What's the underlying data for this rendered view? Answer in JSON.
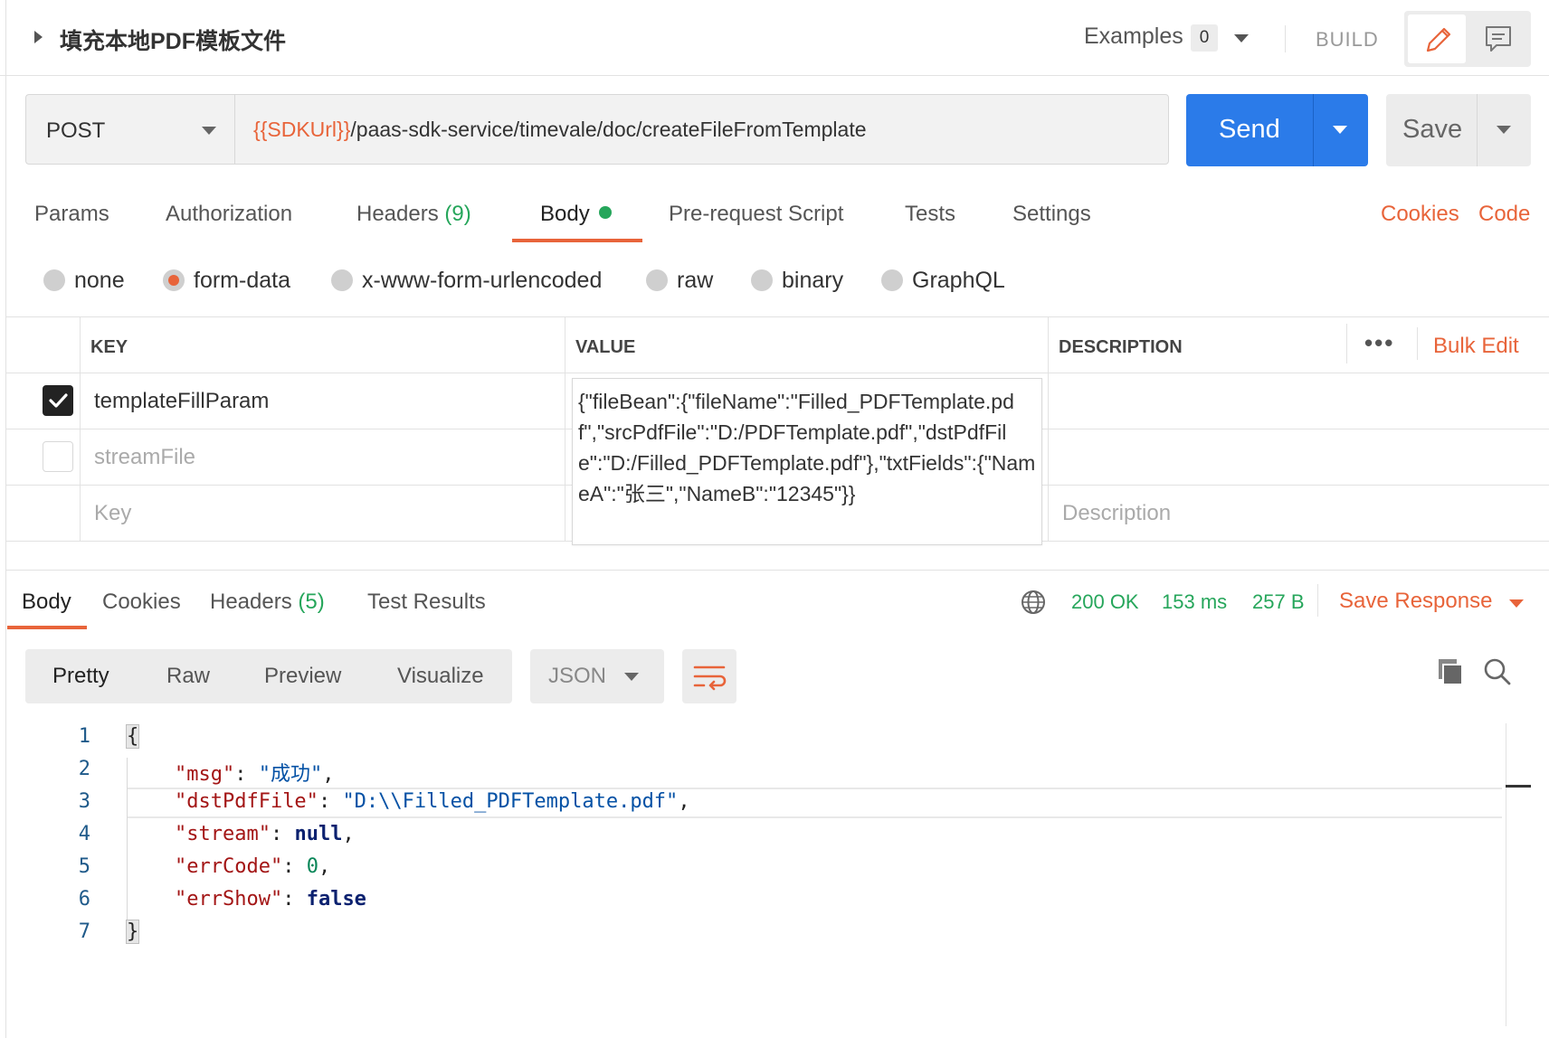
{
  "request": {
    "title": "填充本地PDF模板文件",
    "examples_label": "Examples",
    "examples_count": "0",
    "build_label": "BUILD",
    "method": "POST",
    "url_variable": "{{SDKUrl}}",
    "url_path": "/paas-sdk-service/timevale/doc/createFileFromTemplate",
    "send_label": "Send",
    "save_label": "Save"
  },
  "request_tabs": {
    "params": "Params",
    "authorization": "Authorization",
    "headers": "Headers",
    "headers_count": "(9)",
    "body": "Body",
    "prerequest": "Pre-request Script",
    "tests": "Tests",
    "settings": "Settings",
    "cookies": "Cookies",
    "code": "Code"
  },
  "body_types": {
    "none": "none",
    "form_data": "form-data",
    "urlencoded": "x-www-form-urlencoded",
    "raw": "raw",
    "binary": "binary",
    "graphql": "GraphQL",
    "selected": "form-data"
  },
  "form_table": {
    "headers": {
      "key": "KEY",
      "value": "VALUE",
      "description": "DESCRIPTION"
    },
    "bulk_edit": "Bulk Edit",
    "rows": [
      {
        "key": "templateFillParam",
        "checked": true,
        "value": "{\"fileBean\":{\"fileName\":\"Filled_PDFTemplate.pdf\",\"srcPdfFile\":\"D:/PDFTemplate.pdf\",\"dstPdfFile\":\"D:/Filled_PDFTemplate.pdf\"},\"txtFields\":{\"NameA\":\"张三\",\"NameB\":\"12345\"}}"
      },
      {
        "key": "streamFile",
        "checked": false,
        "value": ""
      }
    ],
    "key_placeholder": "Key",
    "description_placeholder": "Description"
  },
  "response": {
    "tabs": {
      "body": "Body",
      "cookies": "Cookies",
      "headers": "Headers",
      "headers_count": "(5)",
      "test_results": "Test Results"
    },
    "status": "200 OK",
    "time": "153 ms",
    "size": "257 B",
    "save_response": "Save Response",
    "formats": {
      "pretty": "Pretty",
      "raw": "Raw",
      "preview": "Preview",
      "visualize": "Visualize"
    },
    "language": "JSON",
    "line_numbers": [
      "1",
      "2",
      "3",
      "4",
      "5",
      "6",
      "7"
    ],
    "json": {
      "open": "{",
      "close": "}",
      "msg_key": "\"msg\"",
      "msg_val": "\"成功\"",
      "dst_key": "\"dstPdfFile\"",
      "dst_val": "\"D:\\\\Filled_PDFTemplate.pdf\"",
      "stream_key": "\"stream\"",
      "stream_val": "null",
      "errcode_key": "\"errCode\"",
      "errcode_val": "0",
      "errshow_key": "\"errShow\"",
      "errshow_val": "false"
    }
  },
  "colors": {
    "accent": "#e8643a",
    "primary": "#2b7be9",
    "success": "#26a65b"
  },
  "icons": [
    "caret-right-icon",
    "caret-down-icon",
    "pencil-icon",
    "comment-icon",
    "globe-icon",
    "copy-icon",
    "search-icon",
    "wrap-lines-icon",
    "more-dots-icon",
    "checkmark-icon"
  ]
}
